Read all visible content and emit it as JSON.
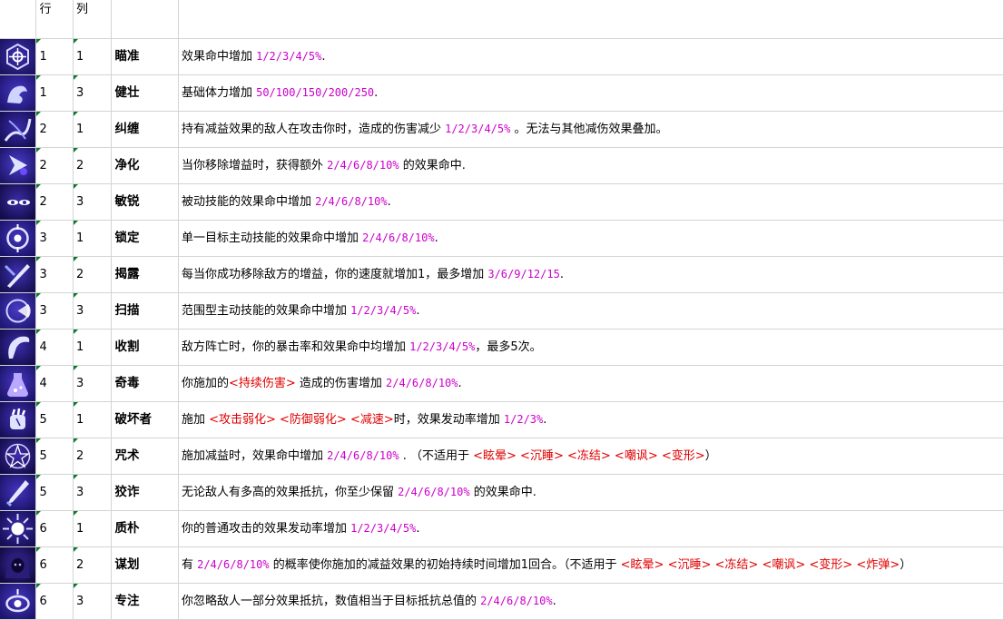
{
  "header": {
    "row_label": "行",
    "col_label": "列"
  },
  "rows": [
    {
      "icon": "crosshair-hexagon-icon",
      "row": "1",
      "col": "1",
      "name": "瞄准",
      "segments": [
        {
          "t": "效果命中增加 ",
          "s": "txt"
        },
        {
          "t": "1/2/3/4/5%",
          "s": "num"
        },
        {
          "t": ".",
          "s": "txt"
        }
      ]
    },
    {
      "icon": "flexed-arm-icon",
      "row": "1",
      "col": "3",
      "name": "健壮",
      "segments": [
        {
          "t": "基础体力增加 ",
          "s": "txt"
        },
        {
          "t": "50/100/150/200/250",
          "s": "num"
        },
        {
          "t": ".",
          "s": "txt"
        }
      ]
    },
    {
      "icon": "tangle-vine-icon",
      "row": "2",
      "col": "1",
      "name": "纠缠",
      "segments": [
        {
          "t": "持有减益效果的敌人在攻击你时，造成的伤害减少 ",
          "s": "txt"
        },
        {
          "t": "1/2/3/4/5%",
          "s": "num"
        },
        {
          "t": " 。无法与其他减伤效果叠加。",
          "s": "txt"
        }
      ]
    },
    {
      "icon": "purify-arrow-icon",
      "row": "2",
      "col": "2",
      "name": "净化",
      "segments": [
        {
          "t": "当你移除增益时，获得额外 ",
          "s": "txt"
        },
        {
          "t": "2/4/6/8/10%",
          "s": "num"
        },
        {
          "t": " 的效果命中.",
          "s": "txt"
        }
      ]
    },
    {
      "icon": "sharp-eyes-icon",
      "row": "2",
      "col": "3",
      "name": "敏锐",
      "segments": [
        {
          "t": "被动技能的效果命中增加 ",
          "s": "txt"
        },
        {
          "t": "2/4/6/8/10%",
          "s": "num"
        },
        {
          "t": ".",
          "s": "txt"
        }
      ]
    },
    {
      "icon": "lock-target-icon",
      "row": "3",
      "col": "1",
      "name": "锁定",
      "segments": [
        {
          "t": "单一目标主动技能的效果命中增加 ",
          "s": "txt"
        },
        {
          "t": "2/4/6/8/10%",
          "s": "num"
        },
        {
          "t": ".",
          "s": "txt"
        }
      ]
    },
    {
      "icon": "reveal-blade-icon",
      "row": "3",
      "col": "2",
      "name": "揭露",
      "segments": [
        {
          "t": "每当你成功移除敌方的增益，你的速度就增加1，最多增加 ",
          "s": "txt"
        },
        {
          "t": "3/6/9/12/15",
          "s": "num"
        },
        {
          "t": ".",
          "s": "txt"
        }
      ]
    },
    {
      "icon": "sweep-radar-icon",
      "row": "3",
      "col": "3",
      "name": "扫描",
      "segments": [
        {
          "t": "范围型主动技能的效果命中增加 ",
          "s": "txt"
        },
        {
          "t": "1/2/3/4/5%",
          "s": "num"
        },
        {
          "t": ".",
          "s": "txt"
        }
      ]
    },
    {
      "icon": "reaper-scythe-icon",
      "row": "4",
      "col": "1",
      "name": "收割",
      "segments": [
        {
          "t": "敌方阵亡时，你的暴击率和效果命中均增加 ",
          "s": "txt"
        },
        {
          "t": "1/2/3/4/5%",
          "s": "num"
        },
        {
          "t": "，最多5次。",
          "s": "txt"
        }
      ]
    },
    {
      "icon": "poison-flask-icon",
      "row": "4",
      "col": "3",
      "name": "奇毒",
      "segments": [
        {
          "t": "你施加的",
          "s": "txt"
        },
        {
          "t": "<持续伤害>",
          "s": "red"
        },
        {
          "t": " 造成的伤害增加 ",
          "s": "txt"
        },
        {
          "t": "2/4/6/8/10%",
          "s": "num"
        },
        {
          "t": ".",
          "s": "txt"
        }
      ]
    },
    {
      "icon": "broken-fist-icon",
      "row": "5",
      "col": "1",
      "name": "破坏者",
      "segments": [
        {
          "t": "施加 ",
          "s": "txt"
        },
        {
          "t": "<攻击弱化>",
          "s": "red"
        },
        {
          "t": " ",
          "s": "txt"
        },
        {
          "t": "<防御弱化>",
          "s": "red"
        },
        {
          "t": " ",
          "s": "txt"
        },
        {
          "t": "<减速>",
          "s": "red"
        },
        {
          "t": "时，效果发动率增加 ",
          "s": "txt"
        },
        {
          "t": "1/2/3%",
          "s": "num"
        },
        {
          "t": ".",
          "s": "txt"
        }
      ]
    },
    {
      "icon": "magic-circle-icon",
      "row": "5",
      "col": "2",
      "name": "咒术",
      "segments": [
        {
          "t": "施加减益时，效果命中增加 ",
          "s": "txt"
        },
        {
          "t": "2/4/6/8/10%",
          "s": "num"
        },
        {
          "t": " . （不适用于 ",
          "s": "txt"
        },
        {
          "t": "<眩晕>",
          "s": "red"
        },
        {
          "t": " ",
          "s": "txt"
        },
        {
          "t": "<沉睡>",
          "s": "red"
        },
        {
          "t": " ",
          "s": "txt"
        },
        {
          "t": "<冻结>",
          "s": "red"
        },
        {
          "t": " ",
          "s": "txt"
        },
        {
          "t": "<嘲讽>",
          "s": "red"
        },
        {
          "t": " ",
          "s": "txt"
        },
        {
          "t": "<变形>",
          "s": "red"
        },
        {
          "t": "）",
          "s": "txt"
        }
      ]
    },
    {
      "icon": "cunning-dagger-icon",
      "row": "5",
      "col": "3",
      "name": "狡诈",
      "segments": [
        {
          "t": "无论敌人有多高的效果抵抗，你至少保留 ",
          "s": "txt"
        },
        {
          "t": "2/4/6/8/10%",
          "s": "num"
        },
        {
          "t": " 的效果命中.",
          "s": "txt"
        }
      ]
    },
    {
      "icon": "energy-burst-icon",
      "row": "6",
      "col": "1",
      "name": "质朴",
      "segments": [
        {
          "t": "你的普通攻击的效果发动率增加 ",
          "s": "txt"
        },
        {
          "t": "1/2/3/4/5%",
          "s": "num"
        },
        {
          "t": ".",
          "s": "txt"
        }
      ]
    },
    {
      "icon": "hooded-schemer-icon",
      "row": "6",
      "col": "2",
      "name": "谋划",
      "segments": [
        {
          "t": "有 ",
          "s": "txt"
        },
        {
          "t": "2/4/6/8/10%",
          "s": "num"
        },
        {
          "t": " 的概率使你施加的减益效果的初始持续时间增加1回合。（不适用于 ",
          "s": "txt"
        },
        {
          "t": "<眩晕>",
          "s": "red"
        },
        {
          "t": " ",
          "s": "txt"
        },
        {
          "t": "<沉睡>",
          "s": "red"
        },
        {
          "t": " ",
          "s": "txt"
        },
        {
          "t": "<冻结>",
          "s": "red"
        },
        {
          "t": " ",
          "s": "txt"
        },
        {
          "t": "<嘲讽>",
          "s": "red"
        },
        {
          "t": " ",
          "s": "txt"
        },
        {
          "t": "<变形>",
          "s": "red"
        },
        {
          "t": " ",
          "s": "txt"
        },
        {
          "t": "<炸弹>",
          "s": "red"
        },
        {
          "t": "）",
          "s": "txt"
        }
      ]
    },
    {
      "icon": "focus-eye-icon",
      "row": "6",
      "col": "3",
      "name": "专注",
      "segments": [
        {
          "t": "你忽略敌人一部分效果抵抗，数值相当于目标抵抗总值的 ",
          "s": "txt"
        },
        {
          "t": "2/4/6/8/10%",
          "s": "num"
        },
        {
          "t": ".",
          "s": "txt"
        }
      ]
    }
  ]
}
